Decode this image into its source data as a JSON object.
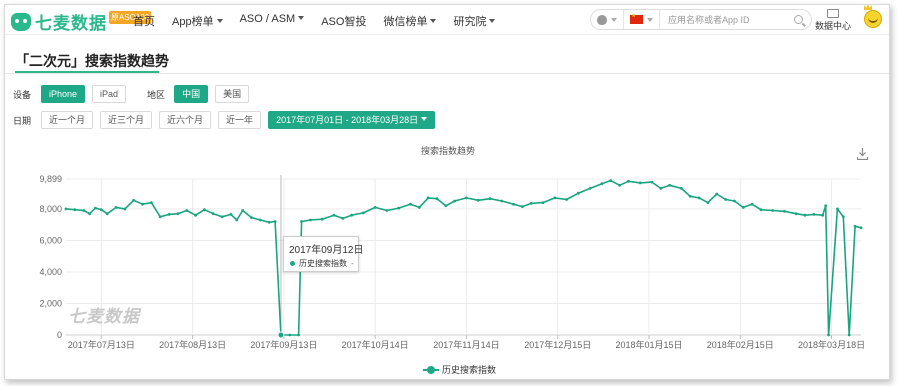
{
  "header": {
    "logo_text": "七麦数据",
    "logo_badge": "原ASO100",
    "nav": [
      {
        "label": "首页",
        "dropdown": false
      },
      {
        "label": "App榜单",
        "dropdown": true
      },
      {
        "label": "ASO / ASM",
        "dropdown": true
      },
      {
        "label": "ASO智投",
        "dropdown": false
      },
      {
        "label": "微信榜单",
        "dropdown": true
      },
      {
        "label": "研究院",
        "dropdown": true
      }
    ],
    "search_placeholder": "应用名称或者App ID",
    "data_center_label": "数据中心"
  },
  "page": {
    "title": "「二次元」搜索指数趋势",
    "device_label": "设备",
    "devices": [
      {
        "label": "iPhone",
        "active": true
      },
      {
        "label": "iPad",
        "active": false
      }
    ],
    "region_label": "地区",
    "regions": [
      {
        "label": "中国",
        "active": true
      },
      {
        "label": "美国",
        "active": false
      }
    ],
    "date_label": "日期",
    "date_ranges": [
      {
        "label": "近一个月"
      },
      {
        "label": "近三个月"
      },
      {
        "label": "近六个月"
      },
      {
        "label": "近一年"
      }
    ],
    "date_picker": "2017年07月01日 - 2018年03月28日"
  },
  "colors": {
    "accent": "#1fa888",
    "line": "#1aa57f"
  },
  "chart_data": {
    "type": "line",
    "title": "搜索指数趋势",
    "watermark": "七麦数据",
    "xlabel": "",
    "ylabel": "",
    "ylim": [
      0,
      9899
    ],
    "y_ticks": [
      "0",
      "2,000",
      "4,000",
      "6,000",
      "8,000",
      "9,899"
    ],
    "x_ticks": [
      "2017年07月13日",
      "2017年08月13日",
      "2017年09月13日",
      "2017年10月14日",
      "2017年11月14日",
      "2017年12月15日",
      "2018年01月15日",
      "2018年02月15日",
      "2018年03月18日"
    ],
    "grid": true,
    "legend_position": "bottom",
    "x_start": "2017-07-01",
    "x_end": "2018-03-28",
    "series": [
      {
        "name": "历史搜索指数",
        "points": [
          [
            "2017-07-01",
            8000
          ],
          [
            "2017-07-04",
            7950
          ],
          [
            "2017-07-07",
            7900
          ],
          [
            "2017-07-09",
            7700
          ],
          [
            "2017-07-11",
            8050
          ],
          [
            "2017-07-13",
            7950
          ],
          [
            "2017-07-15",
            7700
          ],
          [
            "2017-07-18",
            8100
          ],
          [
            "2017-07-21",
            8000
          ],
          [
            "2017-07-24",
            8550
          ],
          [
            "2017-07-27",
            8300
          ],
          [
            "2017-07-30",
            8400
          ],
          [
            "2017-08-02",
            7500
          ],
          [
            "2017-08-05",
            7650
          ],
          [
            "2017-08-08",
            7700
          ],
          [
            "2017-08-11",
            7900
          ],
          [
            "2017-08-14",
            7600
          ],
          [
            "2017-08-17",
            7950
          ],
          [
            "2017-08-20",
            7700
          ],
          [
            "2017-08-23",
            7500
          ],
          [
            "2017-08-26",
            7650
          ],
          [
            "2017-08-28",
            7300
          ],
          [
            "2017-08-30",
            7900
          ],
          [
            "2017-09-02",
            7450
          ],
          [
            "2017-09-05",
            7300
          ],
          [
            "2017-09-08",
            7150
          ],
          [
            "2017-09-10",
            7200
          ],
          [
            "2017-09-12",
            0
          ],
          [
            "2017-09-15",
            0
          ],
          [
            "2017-09-18",
            0
          ],
          [
            "2017-09-19",
            7200
          ],
          [
            "2017-09-22",
            7300
          ],
          [
            "2017-09-26",
            7350
          ],
          [
            "2017-09-30",
            7600
          ],
          [
            "2017-10-03",
            7400
          ],
          [
            "2017-10-06",
            7600
          ],
          [
            "2017-10-10",
            7750
          ],
          [
            "2017-10-14",
            8100
          ],
          [
            "2017-10-18",
            7900
          ],
          [
            "2017-10-22",
            8050
          ],
          [
            "2017-10-26",
            8300
          ],
          [
            "2017-10-29",
            8100
          ],
          [
            "2017-11-01",
            8700
          ],
          [
            "2017-11-04",
            8650
          ],
          [
            "2017-11-07",
            8200
          ],
          [
            "2017-11-10",
            8500
          ],
          [
            "2017-11-14",
            8700
          ],
          [
            "2017-11-18",
            8550
          ],
          [
            "2017-11-22",
            8650
          ],
          [
            "2017-11-26",
            8500
          ],
          [
            "2017-11-30",
            8300
          ],
          [
            "2017-12-03",
            8150
          ],
          [
            "2017-12-06",
            8350
          ],
          [
            "2017-12-10",
            8400
          ],
          [
            "2017-12-14",
            8700
          ],
          [
            "2017-12-18",
            8600
          ],
          [
            "2017-12-22",
            9000
          ],
          [
            "2017-12-26",
            9300
          ],
          [
            "2017-12-30",
            9600
          ],
          [
            "2018-01-02",
            9800
          ],
          [
            "2018-01-05",
            9500
          ],
          [
            "2018-01-08",
            9750
          ],
          [
            "2018-01-12",
            9650
          ],
          [
            "2018-01-16",
            9700
          ],
          [
            "2018-01-19",
            9300
          ],
          [
            "2018-01-22",
            9500
          ],
          [
            "2018-01-26",
            9300
          ],
          [
            "2018-01-29",
            8800
          ],
          [
            "2018-02-01",
            8700
          ],
          [
            "2018-02-04",
            8400
          ],
          [
            "2018-02-07",
            8950
          ],
          [
            "2018-02-10",
            8600
          ],
          [
            "2018-02-13",
            8500
          ],
          [
            "2018-02-16",
            8100
          ],
          [
            "2018-02-19",
            8300
          ],
          [
            "2018-02-22",
            7950
          ],
          [
            "2018-02-26",
            7900
          ],
          [
            "2018-03-02",
            7850
          ],
          [
            "2018-03-06",
            7700
          ],
          [
            "2018-03-09",
            7600
          ],
          [
            "2018-03-12",
            7650
          ],
          [
            "2018-03-15",
            7600
          ],
          [
            "2018-03-16",
            8200
          ],
          [
            "2018-03-17",
            0
          ],
          [
            "2018-03-20",
            8000
          ],
          [
            "2018-03-22",
            7500
          ],
          [
            "2018-03-24",
            0
          ],
          [
            "2018-03-26",
            6900
          ],
          [
            "2018-03-28",
            6800
          ]
        ]
      }
    ],
    "tooltip": {
      "date": "2017年09月12日",
      "series": "历史搜索指数",
      "value": "-"
    }
  }
}
